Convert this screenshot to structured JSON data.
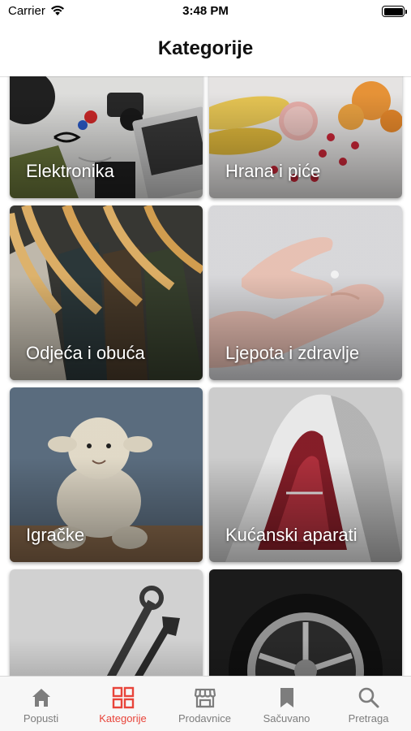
{
  "status_bar": {
    "carrier": "Carrier",
    "time": "3:48 PM"
  },
  "nav": {
    "title": "Kategorije"
  },
  "categories": [
    {
      "label": "Elektronika"
    },
    {
      "label": "Hrana i piće"
    },
    {
      "label": "Odjeća i obuća"
    },
    {
      "label": "Ljepota i zdravlje"
    },
    {
      "label": "Igračke"
    },
    {
      "label": "Kućanski aparati"
    },
    {
      "label": ""
    },
    {
      "label": ""
    }
  ],
  "tabs": [
    {
      "label": "Popusti",
      "icon": "home-icon",
      "active": false
    },
    {
      "label": "Kategorije",
      "icon": "grid-icon",
      "active": true
    },
    {
      "label": "Prodavnice",
      "icon": "store-icon",
      "active": false
    },
    {
      "label": "Sačuvano",
      "icon": "bookmark-icon",
      "active": false
    },
    {
      "label": "Pretraga",
      "icon": "search-icon",
      "active": false
    }
  ],
  "colors": {
    "accent": "#e8443a",
    "inactive": "#7d7d7d",
    "tab_bar_bg": "#f7f7f7"
  }
}
